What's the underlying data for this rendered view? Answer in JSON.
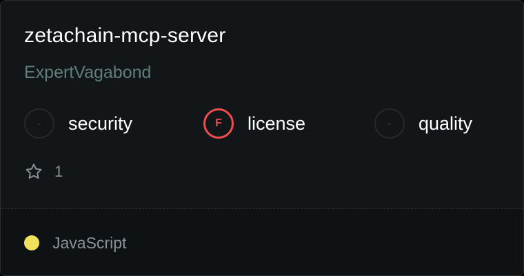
{
  "repo": {
    "name": "zetachain-mcp-server",
    "owner": "ExpertVagabond"
  },
  "scores": [
    {
      "label": "security",
      "grade": "-",
      "status": "none"
    },
    {
      "label": "license",
      "grade": "F",
      "status": "fail",
      "color": "#ef4d50"
    },
    {
      "label": "quality",
      "grade": "-",
      "status": "none"
    }
  ],
  "stars": {
    "icon": "star-outline-icon",
    "count": "1"
  },
  "language": {
    "name": "JavaScript",
    "color": "#f1e05a"
  }
}
